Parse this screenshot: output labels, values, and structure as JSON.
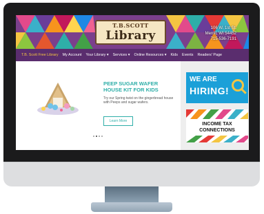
{
  "banner": {
    "logo_top": "T.B.SCOTT",
    "logo_main": "Library",
    "address": [
      "106 W. 1st St.",
      "Merrill, WI 54452",
      "715-536-7191"
    ]
  },
  "nav": {
    "items": [
      {
        "label": "T.B. Scott Free Library",
        "active": true
      },
      {
        "label": "My Account"
      },
      {
        "label": "Your Library ▾"
      },
      {
        "label": "Services ▾"
      },
      {
        "label": "Online Resources ▾"
      },
      {
        "label": "Kids"
      },
      {
        "label": "Events"
      },
      {
        "label": "Readers' Page"
      }
    ]
  },
  "slide": {
    "title_line1": "PEEP SUGAR WAFER",
    "title_line2": "HOUSE KIT FOR KIDS",
    "text": "Try our Spring twist on the gingerbread house with Peeps and sugar wafers.",
    "button": "Learn More"
  },
  "side": {
    "hiring_top": "WE ARE",
    "hiring_main": "HIRING!",
    "tax_line1": "INCOME TAX",
    "tax_line2": "CONNECTIONS"
  },
  "colors": {
    "accent": "#2eaea8",
    "nav": "#5a2d6e",
    "hiring": "#1ba0d8"
  }
}
